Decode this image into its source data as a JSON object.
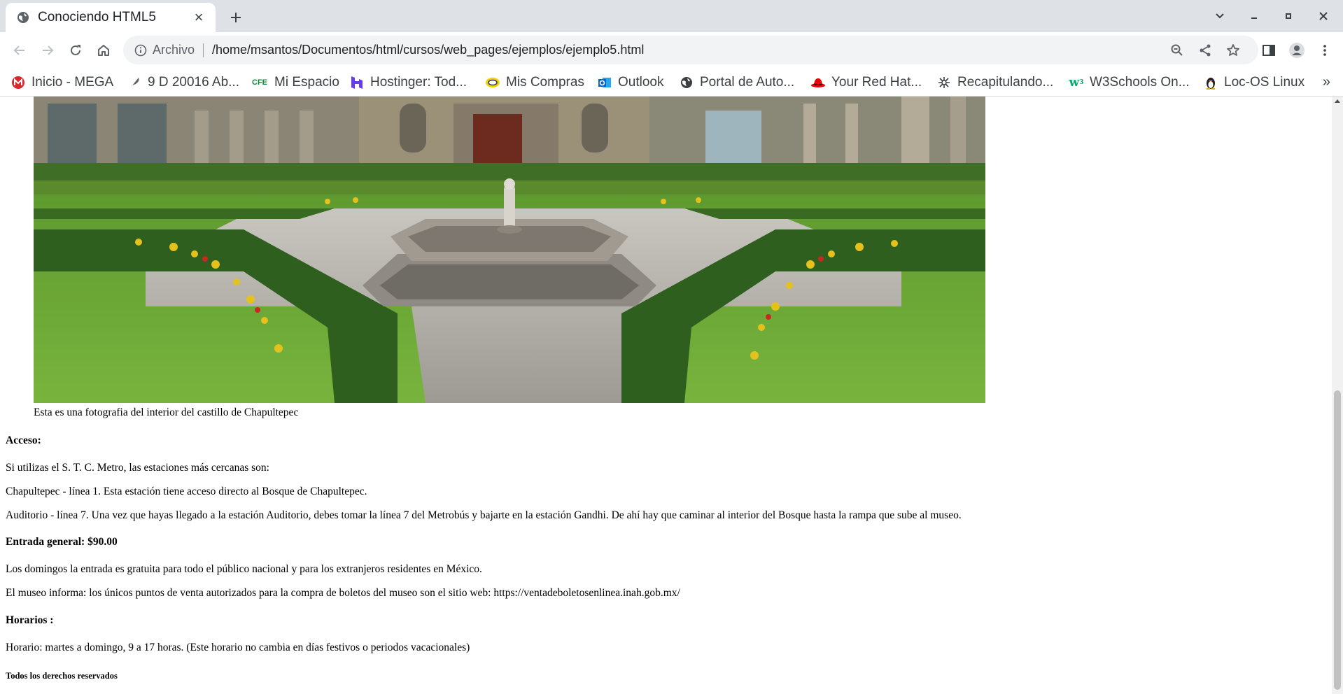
{
  "browser": {
    "tab_title": "Conociendo HTML5",
    "tab_close": "×",
    "new_tab": "+",
    "scheme_label": "Archivo",
    "url": "/home/msantos/Documentos/html/cursos/web_pages/ejemplos/ejemplo5.html"
  },
  "bookmarks": [
    {
      "label": "Inicio - MEGA",
      "icon": "mega-icon",
      "color": "#d9272e"
    },
    {
      "label": "9 D 20016 Ab...",
      "icon": "quill-icon",
      "color": "#5f6368"
    },
    {
      "label": "Mi Espacio",
      "icon": "cfe-icon",
      "color": "#0a8a3a"
    },
    {
      "label": "Hostinger: Tod...",
      "icon": "hostinger-icon",
      "color": "#673de6"
    },
    {
      "label": "Mis Compras",
      "icon": "shopping-icon",
      "color": "#c8a300"
    },
    {
      "label": "Outlook",
      "icon": "outlook-icon",
      "color": "#0a64c9"
    },
    {
      "label": "Portal de Auto...",
      "icon": "globe-icon",
      "color": "#3c4043"
    },
    {
      "label": "Your Red Hat...",
      "icon": "redhat-icon",
      "color": "#e00"
    },
    {
      "label": "Recapitulando...",
      "icon": "asterisk-icon",
      "color": "#3c4043"
    },
    {
      "label": "W3Schools On...",
      "icon": "w3schools-icon",
      "color": "#04aa6d"
    },
    {
      "label": "Loc-OS Linux",
      "icon": "penguin-icon",
      "color": "#3c4043"
    }
  ],
  "bookmarks_more": "»",
  "page": {
    "caption": "Esta es una fotografia del interior del castillo de Chapultepec",
    "acceso_heading": "Acceso:",
    "p_metro": "Si utilizas el S. T. C. Metro, las estaciones más cercanas son:",
    "p_chapultepec": "Chapultepec - línea 1. Esta estación tiene acceso directo al Bosque de Chapultepec.",
    "p_auditorio": "Auditorio - línea 7. Una vez que hayas llegado a la estación Auditorio, debes tomar la línea 7 del Metrobús y bajarte en la estación Gandhi. De ahí hay que caminar al interior del Bosque hasta la rampa que sube al museo.",
    "entrada_heading": "Entrada general: $90.00",
    "p_domingos": "Los domingos la entrada es gratuita para todo el público nacional y para los extranjeros residentes en México.",
    "p_museo": "El museo informa: los únicos puntos de venta autorizados para la compra de boletos del museo son el sitio web: https://ventadeboletosenlinea.inah.gob.mx/",
    "horarios_heading": "Horarios :",
    "p_horario": "Horario: martes a domingo, 9 a 17 horas. (Este horario no cambia en días festivos o periodos vacacionales)",
    "footer": "Todos los derechos reservados"
  }
}
